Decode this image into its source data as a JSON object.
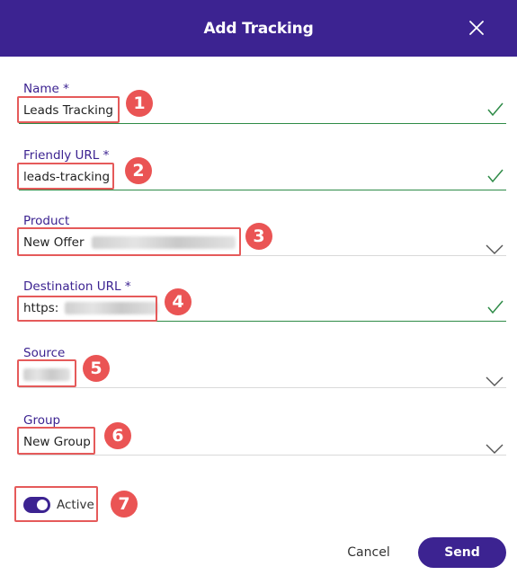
{
  "dialog": {
    "title": "Add Tracking"
  },
  "fields": {
    "name": {
      "label": "Name *",
      "value": "Leads Tracking",
      "state": "valid"
    },
    "friendly_url": {
      "label": "Friendly URL *",
      "value": "leads-tracking",
      "state": "valid"
    },
    "product": {
      "label": "Product",
      "value": "New Offer",
      "control": "dropdown"
    },
    "destination_url": {
      "label": "Destination URL *",
      "value": "https:",
      "state": "valid"
    },
    "source": {
      "label": "Source",
      "value": "",
      "control": "dropdown"
    },
    "group": {
      "label": "Group",
      "value": "New Group",
      "control": "dropdown"
    }
  },
  "active_toggle": {
    "label": "Active",
    "on": true
  },
  "footer": {
    "cancel_label": "Cancel",
    "send_label": "Send"
  },
  "annotations": [
    "1",
    "2",
    "3",
    "4",
    "5",
    "6",
    "7"
  ],
  "colors": {
    "header": "#3c2391",
    "accent": "#3c2391",
    "valid": "#2e8b47",
    "annotation": "#ea5454"
  },
  "icons": {
    "close": "close-icon",
    "valid": "check-icon",
    "dropdown": "chevron-down-icon",
    "toggle": "toggle-switch"
  }
}
